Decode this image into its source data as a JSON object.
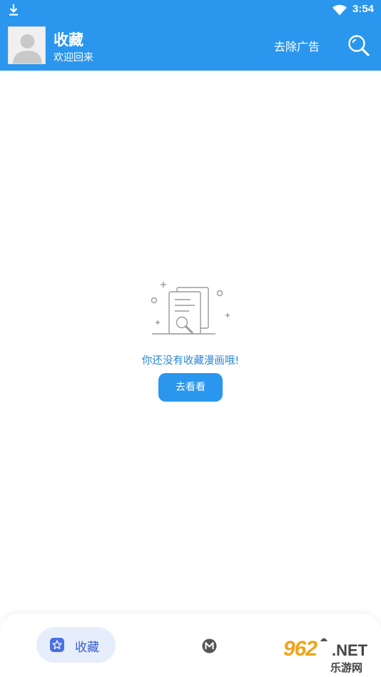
{
  "status_bar": {
    "time": "3:54",
    "icons": [
      "download-icon",
      "wifi-icon"
    ]
  },
  "app_bar": {
    "title": "收藏",
    "subtitle": "欢迎回来",
    "remove_ads_label": "去除广告",
    "avatar_icon": "default-avatar-icon",
    "search_icon": "search-icon",
    "background_color": "#2a96ee"
  },
  "empty_state": {
    "illustration_icon": "empty-document-search-icon",
    "message": "你还没有收藏漫画哦!",
    "button_label": "去看看",
    "accent_color": "#2a96ee"
  },
  "bottom_nav": {
    "items": [
      {
        "label": "收藏",
        "icon": "star-icon",
        "active": true
      },
      {
        "label": "",
        "icon": "m-icon",
        "active": false
      },
      {
        "label": "",
        "icon": "menu-icon",
        "active": false
      }
    ]
  },
  "watermark": {
    "number": "962",
    "suffix": ".NET",
    "chinese": "乐游网"
  }
}
